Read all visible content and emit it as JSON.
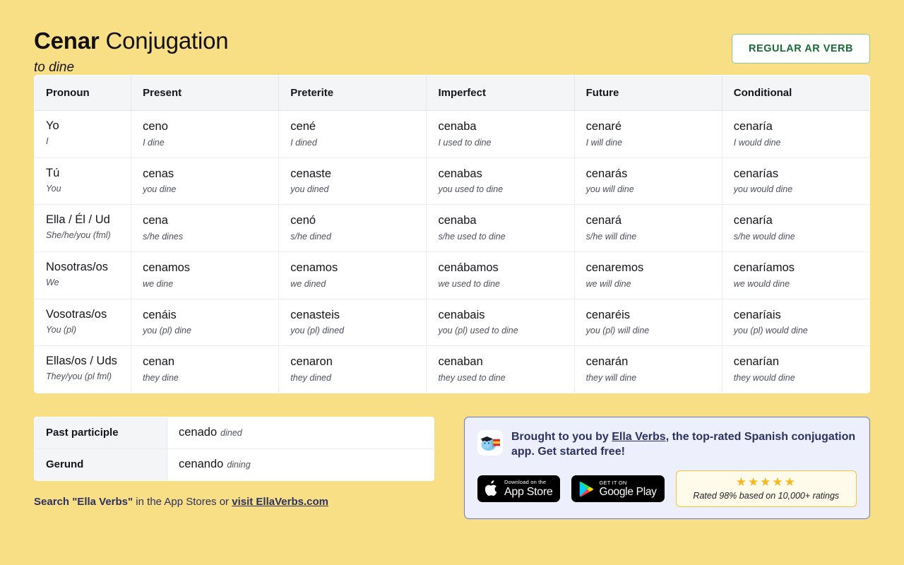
{
  "header": {
    "verb": "Cenar",
    "title_rest": " Conjugation",
    "translation": "to dine",
    "badge": "REGULAR AR VERB"
  },
  "table": {
    "columns": [
      "Pronoun",
      "Present",
      "Preterite",
      "Imperfect",
      "Future",
      "Conditional"
    ],
    "rows": [
      {
        "pronoun": "Yo",
        "pronoun_gloss": "I",
        "present": "ceno",
        "present_gloss": "I dine",
        "preterite": "cené",
        "preterite_gloss": "I dined",
        "imperfect": "cenaba",
        "imperfect_gloss": "I used to dine",
        "future": "cenaré",
        "future_gloss": "I will dine",
        "conditional": "cenaría",
        "conditional_gloss": "I would dine"
      },
      {
        "pronoun": "Tú",
        "pronoun_gloss": "You",
        "present": "cenas",
        "present_gloss": "you dine",
        "preterite": "cenaste",
        "preterite_gloss": "you dined",
        "imperfect": "cenabas",
        "imperfect_gloss": "you used to dine",
        "future": "cenarás",
        "future_gloss": "you will dine",
        "conditional": "cenarías",
        "conditional_gloss": "you would dine"
      },
      {
        "pronoun": "Ella / Él / Ud",
        "pronoun_gloss": "She/he/you (fml)",
        "present": "cena",
        "present_gloss": "s/he dines",
        "preterite": "cenó",
        "preterite_gloss": "s/he dined",
        "imperfect": "cenaba",
        "imperfect_gloss": "s/he used to dine",
        "future": "cenará",
        "future_gloss": "s/he will dine",
        "conditional": "cenaría",
        "conditional_gloss": "s/he would dine"
      },
      {
        "pronoun": "Nosotras/os",
        "pronoun_gloss": "We",
        "present": "cenamos",
        "present_gloss": "we dine",
        "preterite": "cenamos",
        "preterite_gloss": "we dined",
        "imperfect": "cenábamos",
        "imperfect_gloss": "we used to dine",
        "future": "cenaremos",
        "future_gloss": "we will dine",
        "conditional": "cenaríamos",
        "conditional_gloss": "we would dine"
      },
      {
        "pronoun": "Vosotras/os",
        "pronoun_gloss": "You (pl)",
        "present": "cenáis",
        "present_gloss": "you (pl) dine",
        "preterite": "cenasteis",
        "preterite_gloss": "you (pl) dined",
        "imperfect": "cenabais",
        "imperfect_gloss": "you (pl) used to dine",
        "future": "cenaréis",
        "future_gloss": "you (pl) will dine",
        "conditional": "cenaríais",
        "conditional_gloss": "you (pl) would dine"
      },
      {
        "pronoun": "Ellas/os / Uds",
        "pronoun_gloss": "They/you (pl fml)",
        "present": "cenan",
        "present_gloss": "they dine",
        "preterite": "cenaron",
        "preterite_gloss": "they dined",
        "imperfect": "cenaban",
        "imperfect_gloss": "they used to dine",
        "future": "cenarán",
        "future_gloss": "they will dine",
        "conditional": "cenarían",
        "conditional_gloss": "they would dine"
      }
    ]
  },
  "forms": {
    "participle_label": "Past participle",
    "participle_value": "cenado",
    "participle_gloss": "dined",
    "gerund_label": "Gerund",
    "gerund_value": "cenando",
    "gerund_gloss": "dining"
  },
  "search_line": {
    "bold_start": "Search \"Ella Verbs\"",
    "middle": " in the App Stores or ",
    "link": "visit EllaVerbs.com"
  },
  "promo": {
    "text_part1": "Brought to you by ",
    "link": "Ella Verbs",
    "text_part2": ", the top-rated Spanish conjugation app. Get started free!",
    "app_store_small": "Download on the",
    "app_store_big": "App Store",
    "google_play_small": "GET IT ON",
    "google_play_big": "Google Play",
    "stars": "★★★★★",
    "ratings_text": "Rated 98% based on 10,000+ ratings"
  },
  "colors": {
    "background": "#F8DE85",
    "badge_text": "#176B35",
    "badge_border": "#86D08F",
    "promo_bg": "#EDEFFC",
    "promo_border": "#6675D8",
    "navy_text": "#2B3161",
    "star_gold": "#F6B721"
  }
}
